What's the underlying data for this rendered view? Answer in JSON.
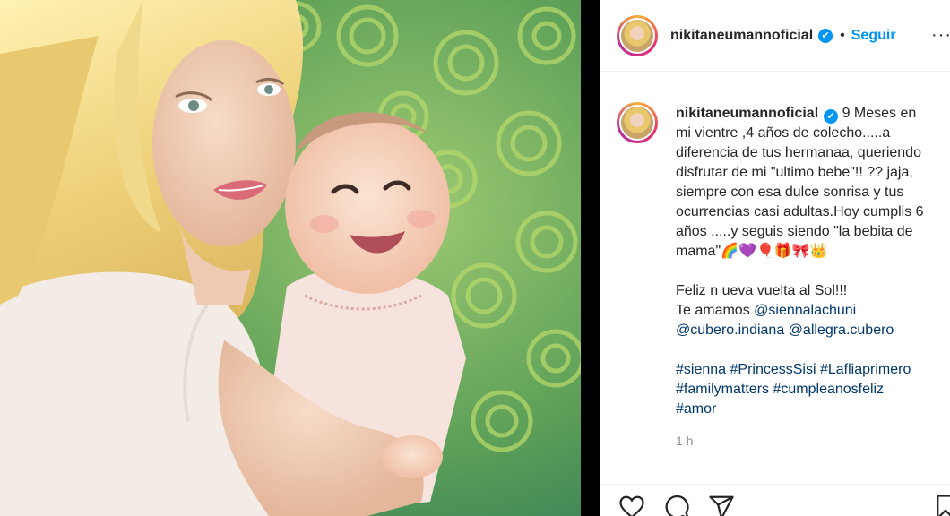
{
  "post": {
    "username": "nikitaneumannoficial",
    "verified_mark": "✔",
    "separator": "•",
    "follow_label": "Seguir",
    "more_label": "···",
    "caption": {
      "username": "nikitaneumannoficial",
      "lines": [
        " 9 Meses en",
        "mi vientre ,4 años de colecho.....a",
        "diferencia de tus hermanaa, queriendo",
        "disfrutar de mi \"ultimo bebe\"!! ?? jaja,",
        "siempre con esa dulce sonrisa y tus",
        "ocurrencias casi adultas.Hoy cumplis 6",
        "años .....y seguis siendo \"la bebita de",
        "mama\"🌈💜🎈🎁🎀👑"
      ],
      "celebration": "Feliz n ueva vuelta al Sol!!!",
      "we_love_prefix": "Te amamos ",
      "mentions": [
        "@siennalachuni",
        "@cubero.indiana",
        "@allegra.cubero"
      ],
      "hashtags_line1": [
        "#sienna",
        "#PrincessSisi",
        "#Lafliaprimero"
      ],
      "hashtags_line2": [
        "#familymatters",
        "#cumpleanosfeliz"
      ],
      "hashtags_line3": [
        "#amor"
      ]
    },
    "timestamp": "1 h"
  },
  "icons": {
    "like": "heart-icon",
    "comment": "comment-icon",
    "share": "paper-plane-icon",
    "save": "bookmark-icon"
  },
  "colors": {
    "link": "#00376b",
    "follow": "#0095f6",
    "verified": "#0095f6",
    "muted": "#8e8e8e",
    "photo_background": "#5fa35d"
  }
}
